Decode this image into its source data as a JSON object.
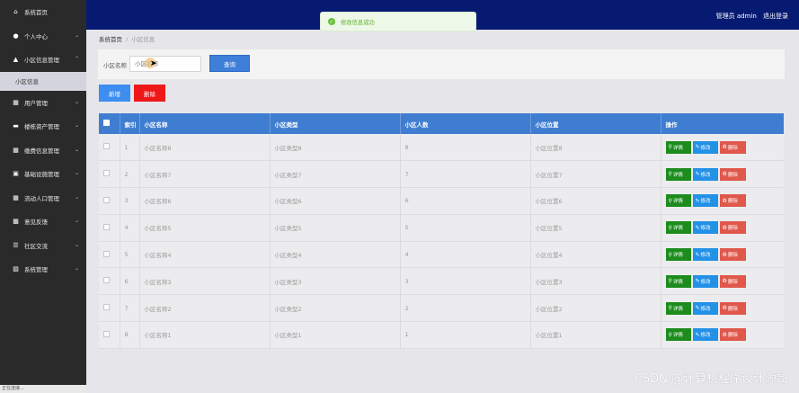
{
  "sidebar": {
    "home": "系统首页",
    "items": [
      {
        "label": "个人中心",
        "icon": "user-icon"
      },
      {
        "label": "小区信息管理",
        "icon": "thumb-icon",
        "sub": "小区信息"
      },
      {
        "label": "用户管理",
        "icon": "grid-icon"
      },
      {
        "label": "楼栋资产管理",
        "icon": "monitor-icon"
      },
      {
        "label": "缴费信息管理",
        "icon": "grid-icon"
      },
      {
        "label": "基础设施管理",
        "icon": "box-icon"
      },
      {
        "label": "流动人口管理",
        "icon": "grid-icon"
      },
      {
        "label": "意见反馈",
        "icon": "clipboard-icon"
      },
      {
        "label": "社区交流",
        "icon": "list-icon"
      },
      {
        "label": "系统管理",
        "icon": "briefcase-icon"
      }
    ],
    "status_text": "正在连接..."
  },
  "topbar": {
    "user_label": "管理员 admin",
    "logout_label": "退出登录"
  },
  "toast": {
    "message": "修改信息成功"
  },
  "breadcrumb": {
    "home": "系统首页",
    "current": "小区信息"
  },
  "search": {
    "label": "小区名称",
    "placeholder": "小区名称",
    "button": "查询"
  },
  "actions": {
    "add": "新增",
    "delete": "删除"
  },
  "table": {
    "columns": [
      "索引",
      "小区名称",
      "小区类型",
      "小区人数",
      "小区位置",
      "操作"
    ],
    "rows": [
      {
        "index": "1",
        "name": "小区名称8",
        "type": "小区类型8",
        "count": "8",
        "location": "小区位置8"
      },
      {
        "index": "2",
        "name": "小区名称7",
        "type": "小区类型7",
        "count": "7",
        "location": "小区位置7"
      },
      {
        "index": "3",
        "name": "小区名称6",
        "type": "小区类型6",
        "count": "6",
        "location": "小区位置6"
      },
      {
        "index": "4",
        "name": "小区名称5",
        "type": "小区类型5",
        "count": "5",
        "location": "小区位置5"
      },
      {
        "index": "5",
        "name": "小区名称4",
        "type": "小区类型4",
        "count": "4",
        "location": "小区位置4"
      },
      {
        "index": "6",
        "name": "小区名称3",
        "type": "小区类型3",
        "count": "3",
        "location": "小区位置3"
      },
      {
        "index": "7",
        "name": "小区名称2",
        "type": "小区类型2",
        "count": "2",
        "location": "小区位置2"
      },
      {
        "index": "8",
        "name": "小区名称1",
        "type": "小区类型1",
        "count": "1",
        "location": "小区位置1"
      }
    ],
    "op_labels": {
      "detail": "详情",
      "edit": "修改",
      "remove": "删除"
    }
  },
  "watermark": "CSDN @计算机程序设计源哥",
  "colors": {
    "topbar": "#071a72",
    "sidebar": "#2a2a2a",
    "table_header": "#3f7dd1",
    "add_button": "#3d8ef0",
    "delete_button": "#ef1818",
    "detail_button": "#1d8c1d",
    "edit_button": "#2391e6",
    "remove_button": "#e0584b"
  }
}
